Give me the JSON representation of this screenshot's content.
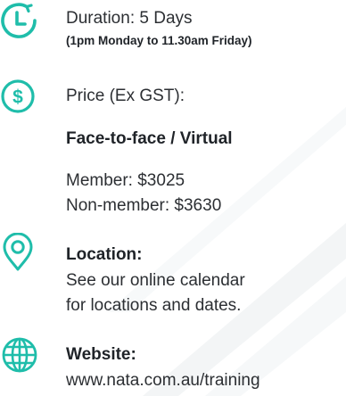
{
  "colors": {
    "accent": "#1fbdaa",
    "text": "#2c2f33",
    "heading": "#1f2328"
  },
  "duration": {
    "icon": "clock-icon",
    "label": "Duration: 5 Days",
    "detail": "(1pm Monday to 11.30am Friday)"
  },
  "price": {
    "icon": "dollar-icon",
    "label": "Price (Ex GST):",
    "mode": "Face-to-face / Virtual",
    "member": "Member: $3025",
    "non_member": "Non-member: $3630"
  },
  "location": {
    "icon": "location-pin-icon",
    "heading": "Location:",
    "line1": "See our online calendar",
    "line2": "for locations and dates."
  },
  "website": {
    "icon": "globe-icon",
    "heading": "Website:",
    "url": "www.nata.com.au/training"
  }
}
